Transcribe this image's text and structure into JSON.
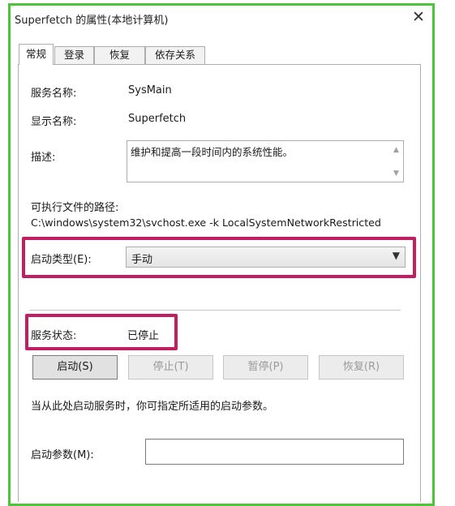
{
  "window": {
    "title": "Superfetch 的属性(本地计算机)",
    "close_glyph": "✕"
  },
  "tabs": [
    {
      "label": "常规",
      "active": true
    },
    {
      "label": "登录",
      "active": false
    },
    {
      "label": "恢复",
      "active": false
    },
    {
      "label": "依存关系",
      "active": false
    }
  ],
  "general": {
    "service_name_label": "服务名称:",
    "service_name_value": "SysMain",
    "display_name_label": "显示名称:",
    "display_name_value": "Superfetch",
    "description_label": "描述:",
    "description_value": "维护和提高一段时间内的系统性能。",
    "exe_path_label": "可执行文件的路径:",
    "exe_path_value": "C:\\windows\\system32\\svchost.exe -k LocalSystemNetworkRestricted",
    "startup_type_label": "启动类型(E):",
    "startup_type_value": "手动",
    "service_status_label": "服务状态:",
    "service_status_value": "已停止",
    "buttons": {
      "start": "启动(S)",
      "stop": "停止(T)",
      "pause": "暂停(P)",
      "resume": "恢复(R)"
    },
    "hint_text": "当从此处启动服务时，你可指定所适用的启动参数。",
    "start_params_label": "启动参数(M):",
    "start_params_value": ""
  },
  "colors": {
    "frame_border": "#4cc43a",
    "highlight": "#c21f62"
  }
}
